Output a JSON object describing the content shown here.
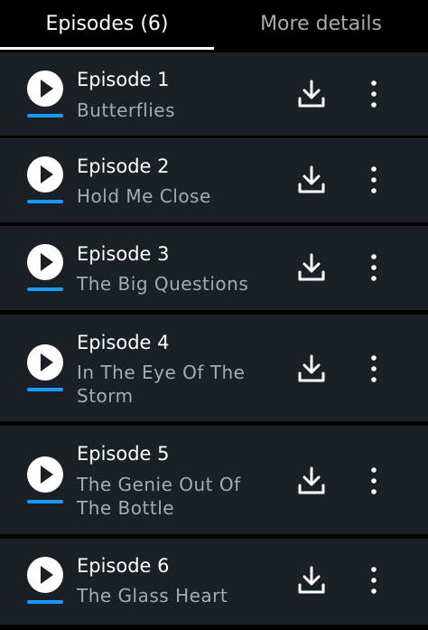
{
  "tabs": {
    "episodes_label": "Episodes (6)",
    "details_label": "More details"
  },
  "colors": {
    "background": "#000000",
    "row_background": "#1b2026",
    "accent": "#1a98ff",
    "secondary_text": "#a5abb1",
    "primary_text": "#ffffff"
  },
  "icons": {
    "play": "play-icon",
    "download": "download-icon",
    "more": "more-vertical-icon"
  },
  "episodes": [
    {
      "title": "Episode 1",
      "subtitle": "Butterflies"
    },
    {
      "title": "Episode 2",
      "subtitle": "Hold Me Close"
    },
    {
      "title": "Episode 3",
      "subtitle": "The Big Questions"
    },
    {
      "title": "Episode 4",
      "subtitle": "In The Eye Of The Storm"
    },
    {
      "title": "Episode 5",
      "subtitle": "The Genie Out Of The Bottle"
    },
    {
      "title": "Episode 6",
      "subtitle": "The Glass Heart"
    }
  ]
}
